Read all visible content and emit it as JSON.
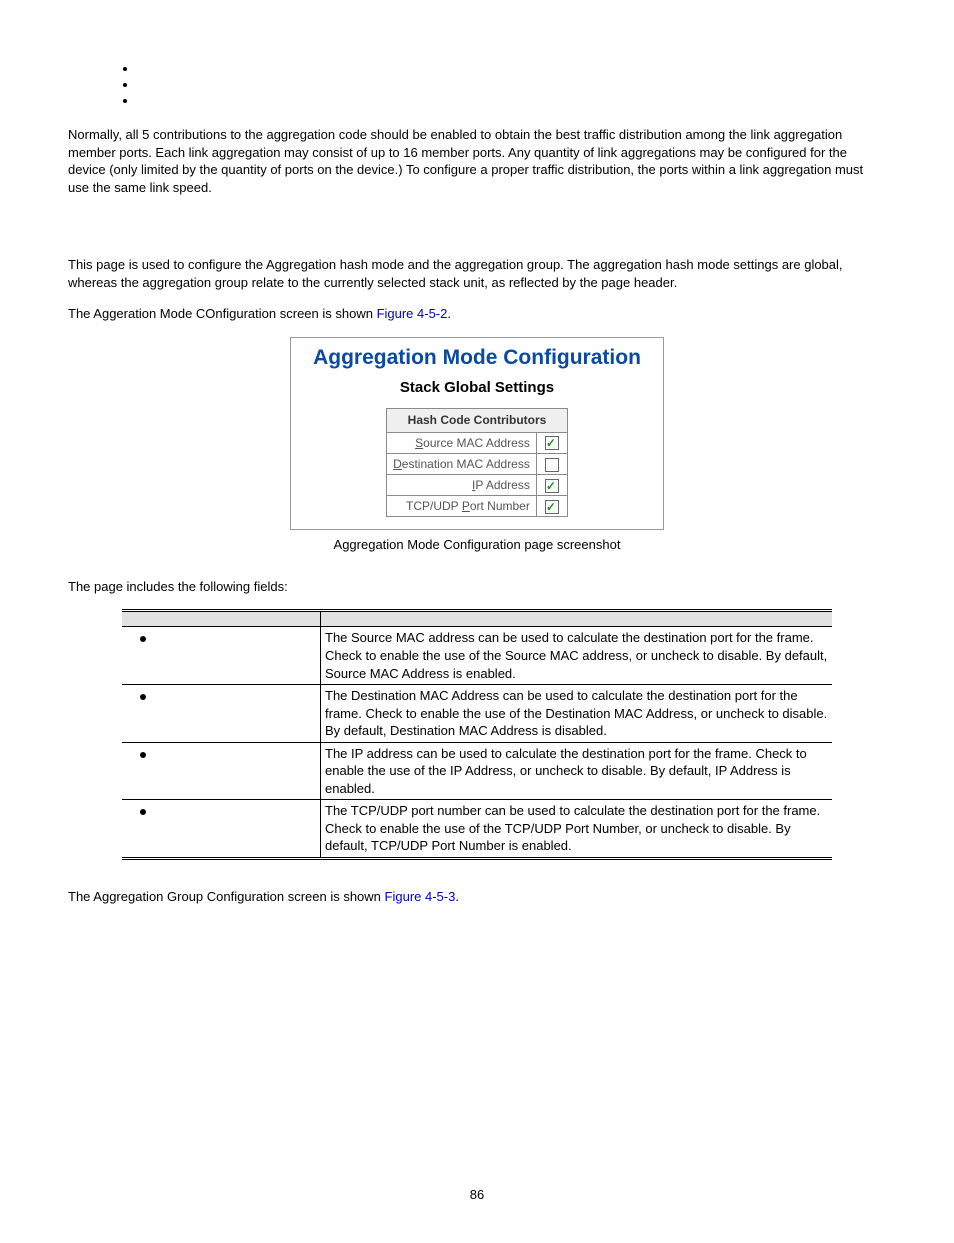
{
  "intro": "Normally, all 5 contributions to the aggregation code should be enabled to obtain the best traffic distribution among the link aggregation member ports. Each link aggregation may consist of up to 16 member ports. Any quantity of link aggregations may be configured for the device (only limited by the quantity of ports on the device.) To configure a proper traffic distribution, the ports within a link aggregation must use the same link speed.",
  "para2": "This page is used to configure the Aggregation hash mode and the aggregation group. The aggregation hash mode settings are global, whereas the aggregation group relate to the currently selected stack unit, as reflected by the page header.",
  "para3_pre": "The Aggeration Mode COnfiguration screen is shown ",
  "para3_link": "Figure 4-5-2",
  "fig": {
    "title": "Aggregation Mode Configuration",
    "sub": "Stack Global Settings",
    "th": "Hash Code Contributors",
    "rows": [
      {
        "label_pre": "",
        "u": "S",
        "label_post": "ource MAC Address",
        "checked": true
      },
      {
        "label_pre": "",
        "u": "D",
        "label_post": "estination MAC Address",
        "checked": false
      },
      {
        "label_pre": "",
        "u": "I",
        "label_post": "P Address",
        "checked": true
      },
      {
        "label_pre": "TCP/UDP ",
        "u": "P",
        "label_post": "ort Number",
        "checked": true
      }
    ]
  },
  "caption": "Aggregation Mode Configuration page screenshot",
  "fields_intro": "The page includes the following fields:",
  "fields": [
    {
      "desc": "The Source MAC address can be used to calculate the destination port for the frame. Check to enable the use of the Source MAC address, or uncheck to disable. By default, Source MAC Address is enabled."
    },
    {
      "desc": "The Destination MAC Address can be used to calculate the destination port for the frame. Check to enable the use of the Destination MAC Address, or uncheck to disable. By default, Destination MAC Address is disabled."
    },
    {
      "desc": "The IP address can be used to calculate the destination port for the frame. Check to enable the use of the IP Address, or uncheck to disable. By default, IP Address is enabled."
    },
    {
      "desc": "The TCP/UDP port number can be used to calculate the destination port for the frame. Check to enable the use of the TCP/UDP Port Number, or uncheck to disable. By default, TCP/UDP Port Number is enabled."
    }
  ],
  "para4_pre": "The Aggregation Group Configuration screen is shown ",
  "para4_link": "Figure 4-5-3",
  "page_number": "86"
}
